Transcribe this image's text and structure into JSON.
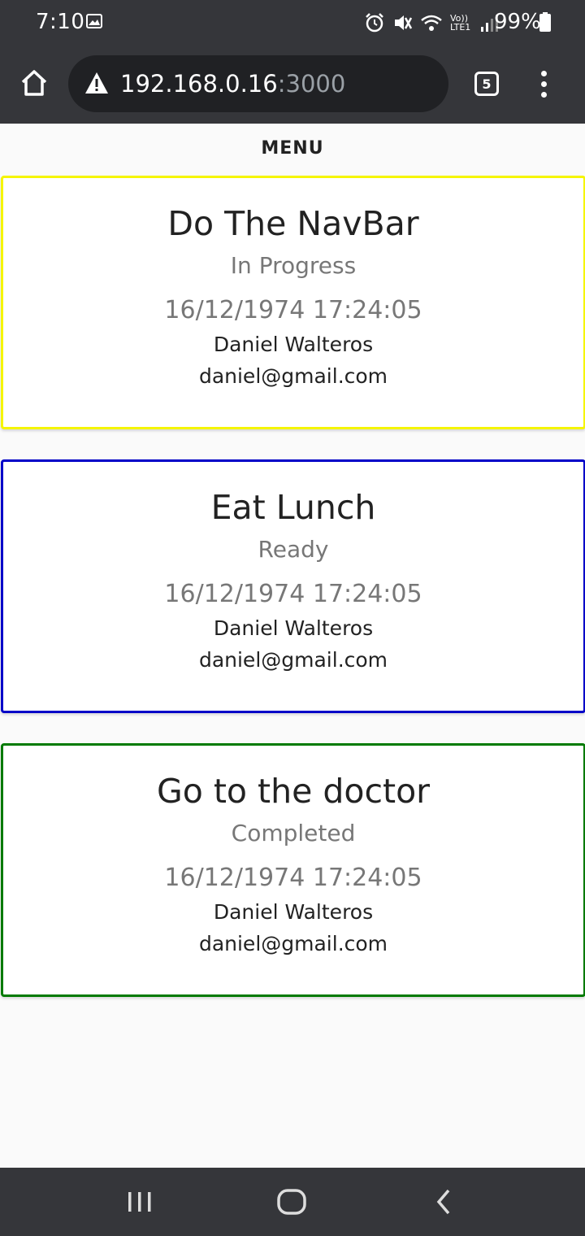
{
  "status_bar": {
    "time": "7:10",
    "battery": "99%",
    "network_label": "Vo)) LTE1"
  },
  "browser": {
    "url_host": "192.168.0.16",
    "url_port": ":3000",
    "tab_count": "5"
  },
  "page": {
    "menu_label": "MENU"
  },
  "tasks": [
    {
      "title": "Do The NavBar",
      "status": "In Progress",
      "datetime": "16/12/1974 17:24:05",
      "name": "Daniel Walteros",
      "email": "daniel@gmail.com",
      "border_color": "#f5f500"
    },
    {
      "title": "Eat Lunch",
      "status": "Ready",
      "datetime": "16/12/1974 17:24:05",
      "name": "Daniel Walteros",
      "email": "daniel@gmail.com",
      "border_color": "#0000c8"
    },
    {
      "title": "Go to the doctor",
      "status": "Completed",
      "datetime": "16/12/1974 17:24:05",
      "name": "Daniel Walteros",
      "email": "daniel@gmail.com",
      "border_color": "#007a00"
    }
  ],
  "colors": {
    "chrome_dark": "#35363a",
    "url_field": "#202124"
  },
  "icons": {
    "status": [
      "gallery-icon",
      "alarm-icon",
      "mute-icon",
      "wifi-icon",
      "signal-icon",
      "battery-icon"
    ],
    "toolbar": [
      "home-icon",
      "warning-icon",
      "tabs-icon",
      "overflow-menu-icon"
    ],
    "system_nav": [
      "recents-icon",
      "home-circle-icon",
      "back-icon"
    ]
  }
}
